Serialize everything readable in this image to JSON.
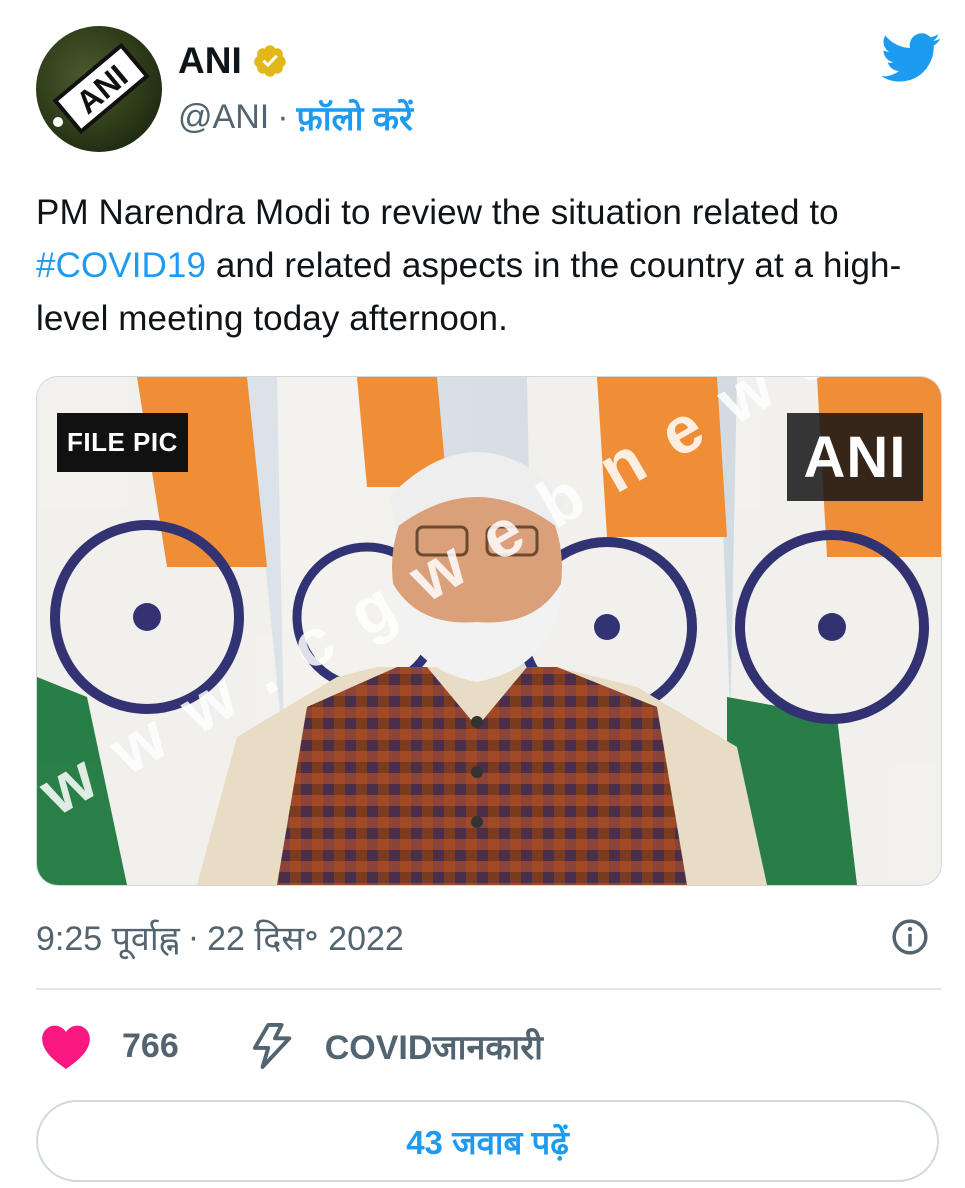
{
  "author": {
    "name": "ANI",
    "handle": "@ANI",
    "separator": "·",
    "follow_label": "फ़ॉलो करें",
    "avatar_text": "ANI",
    "verified_color": "#e2b719"
  },
  "tweet": {
    "text_before": "PM Narendra Modi to review the situation related to ",
    "hashtag": "#COVID19",
    "text_after": " and related aspects in the country at a high-level meeting today afternoon."
  },
  "media": {
    "label": "FILE PIC",
    "watermark": "ANI",
    "overlay_watermark": "www.cgwebnews.i"
  },
  "meta": {
    "time": "9:25 पूर्वाह्न",
    "separator": "·",
    "date": "22 दिस॰ 2022"
  },
  "actions": {
    "like_count": "766",
    "topic_label": "COVIDजानकारी"
  },
  "replies_label": "43 जवाब पढ़ें",
  "colors": {
    "accent": "#1d9bf0",
    "like": "#f91880",
    "muted": "#536471",
    "text": "#0f1419"
  },
  "icons": [
    "verified-badge-icon",
    "twitter-bird-icon",
    "info-icon",
    "heart-icon",
    "lightning-bolt-icon"
  ]
}
